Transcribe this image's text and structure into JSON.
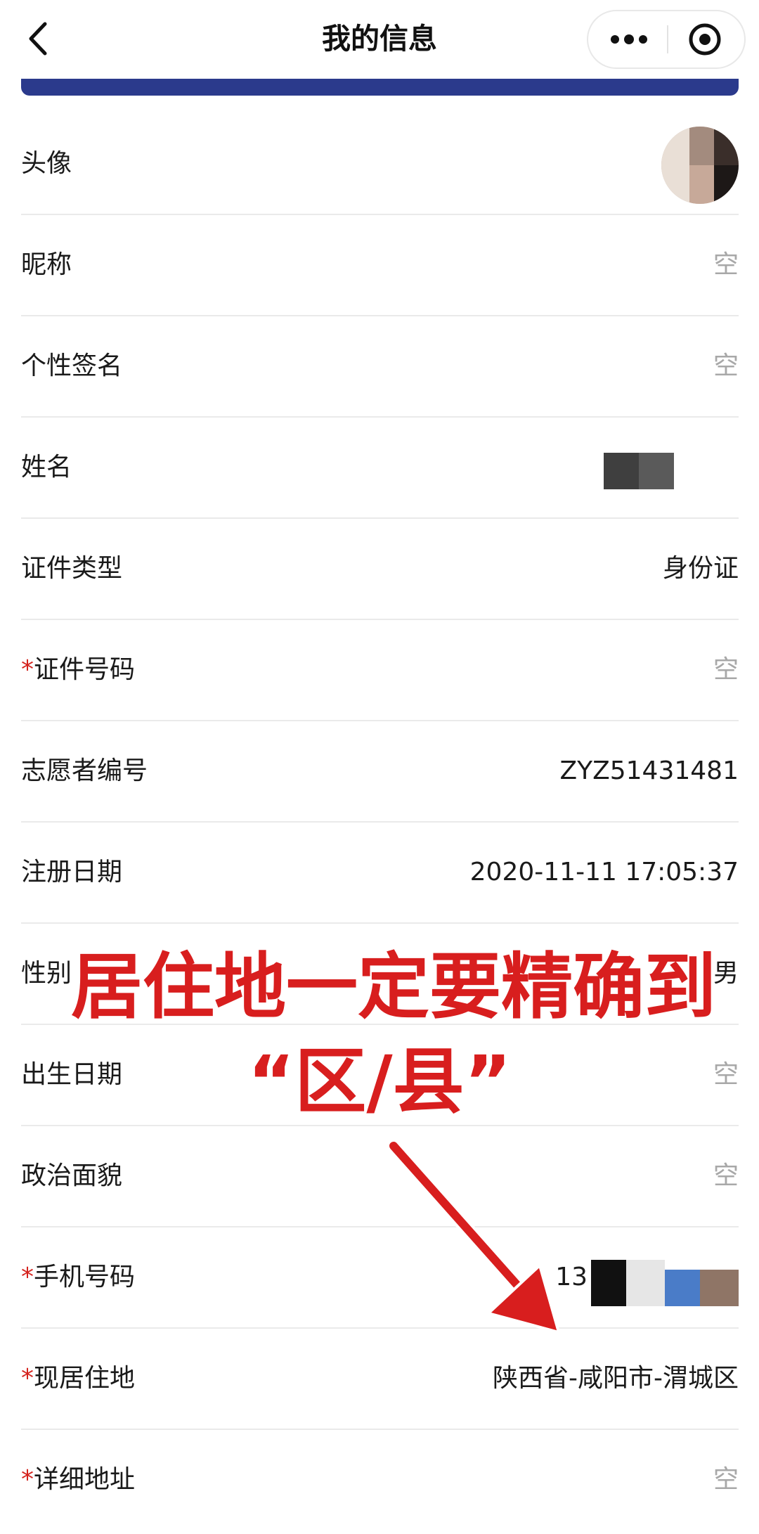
{
  "header": {
    "title": "我的信息",
    "back_icon": "chevron-left-icon",
    "more_icon": "more-dots-icon",
    "close_icon": "target-close-icon"
  },
  "colors": {
    "accent_blue": "#2b3a8c",
    "required_star": "#d4231e",
    "placeholder_gray": "#a8a8a8",
    "annotation_red": "#d81e1e"
  },
  "rows": [
    {
      "label": "头像",
      "required": false,
      "value": "",
      "kind": "avatar"
    },
    {
      "label": "昵称",
      "required": false,
      "value": "空",
      "kind": "empty"
    },
    {
      "label": "个性签名",
      "required": false,
      "value": "空",
      "kind": "empty"
    },
    {
      "label": "姓名",
      "required": false,
      "value": "",
      "kind": "redacted"
    },
    {
      "label": "证件类型",
      "required": false,
      "value": "身份证",
      "kind": "text"
    },
    {
      "label": "证件号码",
      "required": true,
      "value": "空",
      "kind": "empty"
    },
    {
      "label": "志愿者编号",
      "required": false,
      "value": "ZYZ51431481",
      "kind": "text"
    },
    {
      "label": "注册日期",
      "required": false,
      "value": "2020-11-11 17:05:37",
      "kind": "text"
    },
    {
      "label": "性别",
      "required": false,
      "value": "男",
      "kind": "text"
    },
    {
      "label": "出生日期",
      "required": false,
      "value": "空",
      "kind": "empty"
    },
    {
      "label": "政治面貌",
      "required": false,
      "value": "空",
      "kind": "empty"
    },
    {
      "label": "手机号码",
      "required": true,
      "value": "13",
      "kind": "partial-redacted"
    },
    {
      "label": "现居住地",
      "required": true,
      "value": "陕西省-咸阳市-渭城区",
      "kind": "text"
    },
    {
      "label": "详细地址",
      "required": true,
      "value": "空",
      "kind": "empty"
    }
  ],
  "annotation": {
    "line1": "居住地一定要精确到",
    "line2": "“区/县”",
    "arrow_icon": "red-arrow-down-right-icon"
  }
}
